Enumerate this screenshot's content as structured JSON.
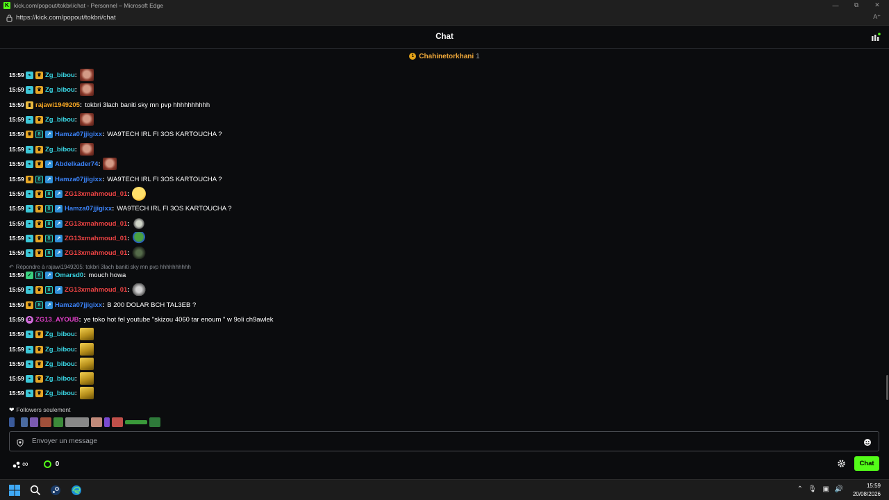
{
  "window": {
    "title": "kick.com/popout/tokbri/chat - Personnel – Microsoft Edge",
    "url": "https://kick.com/popout/tokbri/chat"
  },
  "header": {
    "title": "Chat"
  },
  "pinned": {
    "name": "Chahinetorkhani",
    "count": "1"
  },
  "colors": {
    "accent": "#53fc18",
    "background": "#0b0c0e",
    "name_cyan": "#3ad8e6",
    "name_blue": "#3b82f6",
    "name_red": "#ef4444",
    "name_orange": "#f5a623",
    "name_pink": "#e040c8"
  },
  "messages": [
    {
      "time": "15:59",
      "badges": [
        "sub",
        "crown"
      ],
      "user": "Zg_bibou",
      "color": "#3ad8e6",
      "text": "",
      "emote": "face"
    },
    {
      "time": "15:59",
      "badges": [
        "sub",
        "crown"
      ],
      "user": "Zg_bibou",
      "color": "#3ad8e6",
      "text": "",
      "emote": "face"
    },
    {
      "time": "15:59",
      "badges": [
        "gift"
      ],
      "user": "rajawi1949205",
      "color": "#f5a623",
      "text": "tokbri 3lach baniti sky mn pvp hhhhhhhhhh",
      "emote": ""
    },
    {
      "time": "15:59",
      "badges": [
        "sub",
        "crown"
      ],
      "user": "Zg_bibou",
      "color": "#3ad8e6",
      "text": "",
      "emote": "face"
    },
    {
      "time": "15:59",
      "badges": [
        "crown",
        "og",
        "vip"
      ],
      "user": "Hamza07jjigixx",
      "color": "#3b82f6",
      "text": "WA9TECH IRL FI 3OS KARTOUCHA ?",
      "emote": ""
    },
    {
      "time": "15:59",
      "badges": [
        "sub",
        "crown"
      ],
      "user": "Zg_bibou",
      "color": "#3ad8e6",
      "text": "",
      "emote": "face"
    },
    {
      "time": "15:59",
      "badges": [
        "sub",
        "crown",
        "vip"
      ],
      "user": "Abdelkader74",
      "color": "#3b82f6",
      "text": "",
      "emote": "face"
    },
    {
      "time": "15:59",
      "badges": [
        "crown",
        "og",
        "vip"
      ],
      "user": "Hamza07jjigixx",
      "color": "#3b82f6",
      "text": "WA9TECH IRL FI 3OS KARTOUCHA ?",
      "emote": ""
    },
    {
      "time": "15:59",
      "badges": [
        "sub",
        "crown",
        "og",
        "vip"
      ],
      "user": "ZG13xmahmoud_01",
      "color": "#ef4444",
      "text": "",
      "emote": "smile"
    },
    {
      "time": "15:59",
      "badges": [
        "sub",
        "crown",
        "og",
        "vip"
      ],
      "user": "Hamza07jjigixx",
      "color": "#3b82f6",
      "text": "WA9TECH IRL FI 3OS KARTOUCHA ?",
      "emote": ""
    },
    {
      "time": "15:59",
      "badges": [
        "sub",
        "crown",
        "og",
        "vip"
      ],
      "user": "ZG13xmahmoud_01",
      "color": "#ef4444",
      "text": "",
      "emote": "pale"
    },
    {
      "time": "15:59",
      "badges": [
        "sub",
        "crown",
        "og",
        "vip"
      ],
      "user": "ZG13xmahmoud_01",
      "color": "#ef4444",
      "text": "",
      "emote": "pepe"
    },
    {
      "time": "15:59",
      "badges": [
        "sub",
        "crown",
        "og",
        "vip"
      ],
      "user": "ZG13xmahmoud_01",
      "color": "#ef4444",
      "text": "",
      "emote": "dark"
    },
    {
      "time": "15:59",
      "badges": [
        "green",
        "og",
        "vip"
      ],
      "user": "Omarsd0",
      "color": "#3ad8e6",
      "text": "mouch howa",
      "emote": ""
    },
    {
      "time": "15:59",
      "badges": [
        "sub",
        "crown",
        "og",
        "vip"
      ],
      "user": "ZG13xmahmoud_01",
      "color": "#ef4444",
      "text": "",
      "emote": "grey"
    },
    {
      "time": "15:59",
      "badges": [
        "crown",
        "og",
        "vip"
      ],
      "user": "Hamza07jjigixx",
      "color": "#3b82f6",
      "text": "B 200 DOLAR BCH TAL3EB ?",
      "emote": ""
    },
    {
      "time": "15:59",
      "badges": [
        "pink"
      ],
      "user": "ZG13_AYOUB",
      "color": "#e040c8",
      "text": "ye toko hot fel youtube \"skizou 4060 tar enoum \" w 9oli ch9awlek",
      "emote": ""
    },
    {
      "time": "15:59",
      "badges": [
        "sub",
        "crown"
      ],
      "user": "Zg_bibou",
      "color": "#3ad8e6",
      "text": "",
      "emote": "gold"
    },
    {
      "time": "15:59",
      "badges": [
        "sub",
        "crown"
      ],
      "user": "Zg_bibou",
      "color": "#3ad8e6",
      "text": "",
      "emote": "gold"
    },
    {
      "time": "15:59",
      "badges": [
        "sub",
        "crown"
      ],
      "user": "Zg_bibou",
      "color": "#3ad8e6",
      "text": "",
      "emote": "gold"
    },
    {
      "time": "15:59",
      "badges": [
        "sub",
        "crown"
      ],
      "user": "Zg_bibou",
      "color": "#3ad8e6",
      "text": "",
      "emote": "gold"
    },
    {
      "time": "15:59",
      "badges": [
        "sub",
        "crown"
      ],
      "user": "Zg_bibou",
      "color": "#3ad8e6",
      "text": "",
      "emote": "gold"
    }
  ],
  "reply": {
    "text": "Répondre à rajawi1949205: tokbri 3lach baniti sky mn pvp hhhhhhhhhh"
  },
  "followers_label": "Followers seulement",
  "input": {
    "placeholder": "Envoyer un message"
  },
  "bottom": {
    "infinity": "∞",
    "coins": "0",
    "chat_button": "Chat"
  },
  "taskbar": {
    "time": "15:59",
    "date": "20/08/2026"
  }
}
